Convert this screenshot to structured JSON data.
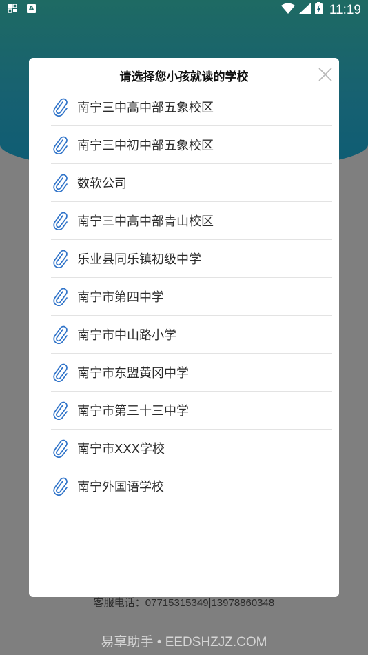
{
  "status_bar": {
    "time": "11:19",
    "left_icons": [
      "grid-icon",
      "a-badge-icon"
    ],
    "right_icons": [
      "wifi-icon",
      "signal-icon",
      "battery-charging-icon"
    ]
  },
  "dialog": {
    "title": "请选择您小孩就读的学校",
    "close_icon": "close-icon",
    "item_icon": "paperclip-icon",
    "schools": [
      {
        "name": "南宁三中高中部五象校区"
      },
      {
        "name": "南宁三中初中部五象校区"
      },
      {
        "name": "数软公司"
      },
      {
        "name": "南宁三中高中部青山校区"
      },
      {
        "name": "乐业县同乐镇初级中学"
      },
      {
        "name": "南宁市第四中学"
      },
      {
        "name": "南宁市中山路小学"
      },
      {
        "name": "南宁市东盟黄冈中学"
      },
      {
        "name": "南宁市第三十三中学"
      },
      {
        "name": "南宁市XXX学校"
      },
      {
        "name": "南宁外国语学校"
      }
    ]
  },
  "footer": {
    "service_phone": "客服电话：07715315349|13978860348"
  },
  "watermark": "易享助手 • EEDSHZJZ.COM",
  "colors": {
    "header_teal": "#1e6a63",
    "header_blue": "#0e5c74",
    "overlay_gray": "#7f7f7f",
    "icon_blue": "#2f73c9"
  }
}
